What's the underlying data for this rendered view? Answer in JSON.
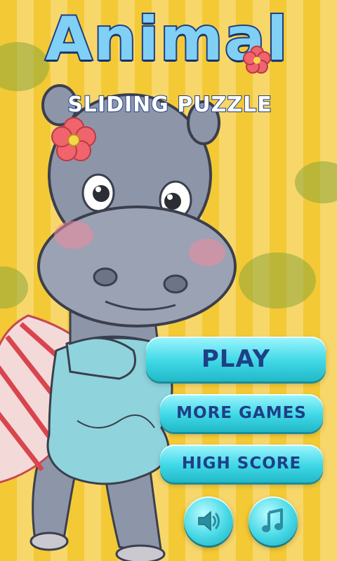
{
  "title": {
    "main": "Animal",
    "sub": "SLIDING PUZZLE"
  },
  "menu": {
    "play": "PLAY",
    "more_games": "MORE GAMES",
    "high_score": "HIGH SCORE"
  },
  "controls": {
    "sound_icon": "speaker-icon",
    "music_icon": "music-note-icon"
  },
  "colors": {
    "stripe_dark": "#f3c935",
    "stripe_light": "#f7d76a",
    "button": "#3fd8e6",
    "title_fill": "#7fd0f4",
    "title_outline": "#1f3f86",
    "hippo": "#8d96a8"
  }
}
